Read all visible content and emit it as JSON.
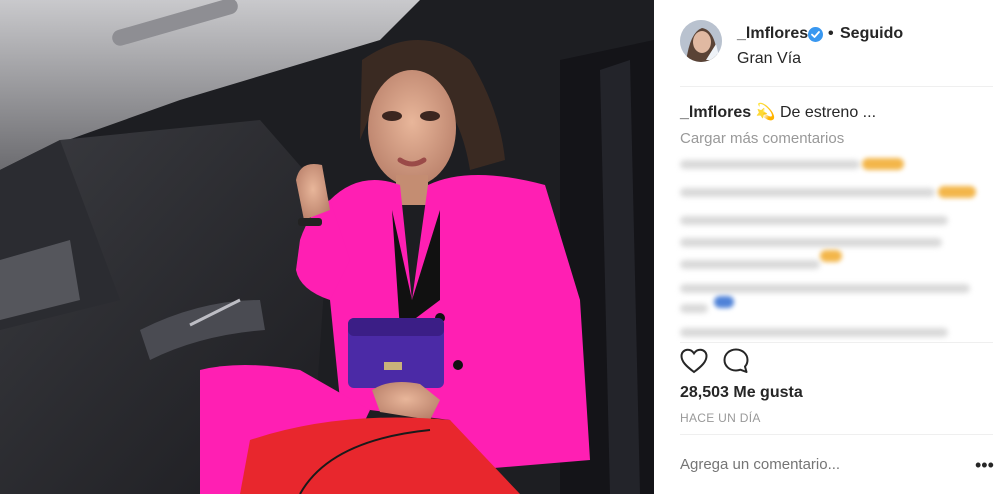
{
  "post": {
    "username": "_lmflores",
    "follow_dot": "•",
    "follow_status": "Seguido",
    "location": "Gran Vía",
    "caption_user": "_lmflores",
    "caption_text": "💫 De estreno ...",
    "load_more": "Cargar más comentarios",
    "likes": "28,503 Me gusta",
    "timestamp": "HACE UN DÍA",
    "comment_placeholder": "Agrega un comentario...",
    "more_glyph": "•••"
  },
  "colors": {
    "verified": "#3897f0",
    "text": "#262626",
    "muted": "#999999",
    "jacket_pink": "#ff1fb3",
    "trousers_red": "#e8272d",
    "bag_purple": "#4b2aa6"
  },
  "icons": {
    "like": "heart-icon",
    "comment": "comment-bubble-icon",
    "verified": "verified-badge-icon",
    "options": "more-options-icon"
  }
}
